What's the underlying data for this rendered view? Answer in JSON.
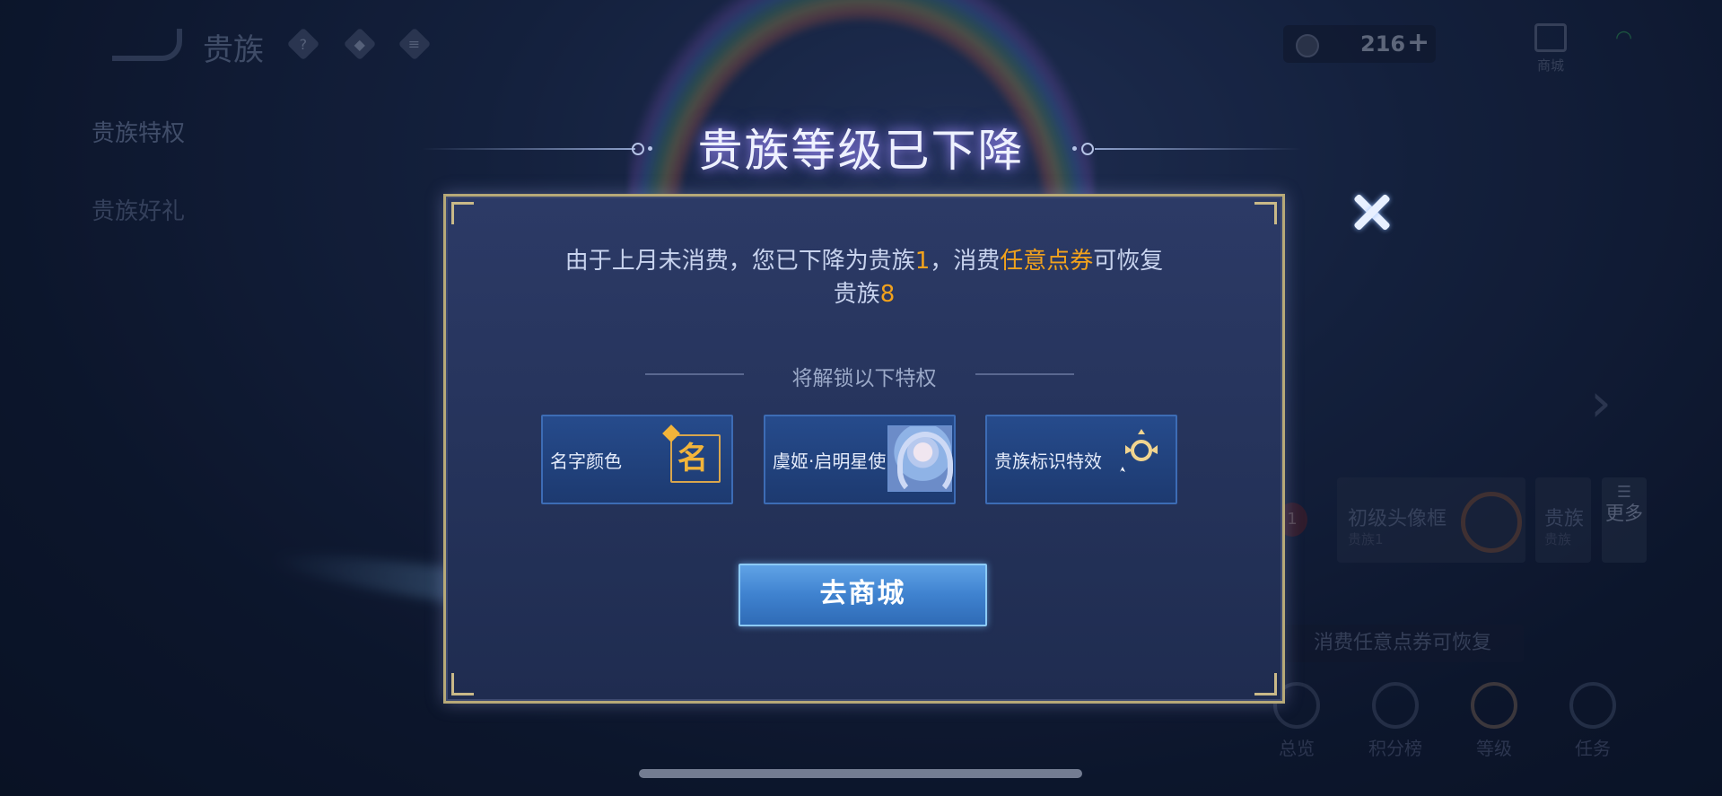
{
  "background": {
    "top_bar": {
      "title": "贵族",
      "help_icon": "question-icon",
      "currency_amount": "216",
      "currency_plus": "+",
      "shop_label": "商城"
    },
    "side_nav": {
      "items": [
        {
          "label": "贵族特权",
          "active": true
        },
        {
          "label": "贵族好礼",
          "active": false
        }
      ]
    },
    "privilege_cards": [
      {
        "title": "初级头像框",
        "subtitle": "贵族1"
      },
      {
        "title": "贵族",
        "subtitle": "贵族"
      }
    ],
    "rank_badge": "1",
    "more_label": "更多",
    "restore_tip": "消费任意点券可恢复",
    "bottom_tabs": [
      {
        "label": "总览",
        "active": false
      },
      {
        "label": "积分榜",
        "active": false
      },
      {
        "label": "等级",
        "active": true
      },
      {
        "label": "任务",
        "active": false
      }
    ]
  },
  "modal": {
    "title": "贵族等级已下降",
    "message_part1": "由于上月未消费，您已下降为贵族",
    "current_level": "1",
    "message_part2": "，消费",
    "highlight_currency": "任意点券",
    "message_part3": "可恢复",
    "message_part4": "贵族",
    "restore_level": "8",
    "unlock_heading": "将解锁以下特权",
    "privileges": [
      {
        "label": "名字颜色",
        "icon": "name-color-icon",
        "icon_char": "名"
      },
      {
        "label": "虞姬·启明星使",
        "icon": "hero-skin-thumbnail"
      },
      {
        "label": "贵族标识特效",
        "icon": "noble-emblem-icon"
      }
    ],
    "goto_button": "去商城",
    "close_icon": "close-icon"
  },
  "colors": {
    "highlight": "#f2a21c",
    "button": "#3f82cf",
    "modal_bg": "#2c3a66",
    "border_gold": "#b7a978"
  }
}
